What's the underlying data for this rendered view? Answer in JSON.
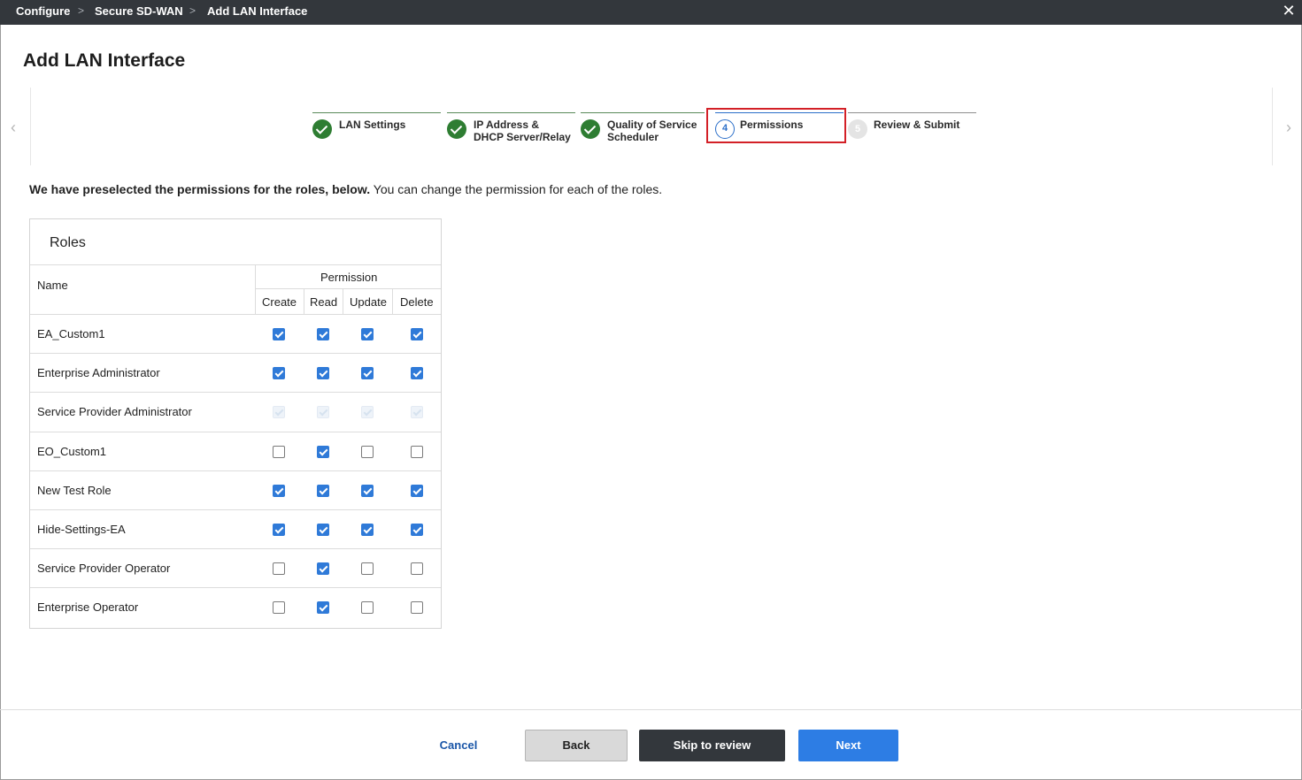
{
  "breadcrumb": {
    "items": [
      "Configure",
      "Secure SD-WAN",
      "Add LAN Interface"
    ],
    "separator": ">"
  },
  "close_icon": "close-icon",
  "page_title": "Add LAN Interface",
  "wizard": {
    "steps": [
      {
        "label": "LAN Settings",
        "status": "completed"
      },
      {
        "label": "IP Address & DHCP Server/Relay",
        "status": "completed"
      },
      {
        "label": "Quality of Service Scheduler",
        "status": "completed"
      },
      {
        "label": "Permissions",
        "status": "current",
        "number": "4"
      },
      {
        "label": "Review & Submit",
        "status": "upcoming",
        "number": "5"
      }
    ],
    "prev_arrow": "‹",
    "next_arrow": "›"
  },
  "intro": {
    "bold": "We have preselected the permissions for the roles, below.",
    "rest": " You can change the permission for each of the roles."
  },
  "roles": {
    "title": "Roles",
    "name_header": "Name",
    "permission_header": "Permission",
    "columns": [
      "Create",
      "Read",
      "Update",
      "Delete"
    ],
    "rows": [
      {
        "name": "EA_Custom1",
        "perms": [
          "on",
          "on",
          "on",
          "on"
        ]
      },
      {
        "name": "Enterprise Administrator",
        "perms": [
          "on",
          "on",
          "on",
          "on"
        ]
      },
      {
        "name": "Service Provider Administrator",
        "perms": [
          "dis",
          "dis",
          "dis",
          "dis"
        ]
      },
      {
        "name": "EO_Custom1",
        "perms": [
          "off",
          "on",
          "off",
          "off"
        ]
      },
      {
        "name": "New Test Role",
        "perms": [
          "on",
          "on",
          "on",
          "on"
        ]
      },
      {
        "name": "Hide-Settings-EA",
        "perms": [
          "on",
          "on",
          "on",
          "on"
        ]
      },
      {
        "name": "Service Provider Operator",
        "perms": [
          "off",
          "on",
          "off",
          "off"
        ]
      },
      {
        "name": "Enterprise Operator",
        "perms": [
          "off",
          "on",
          "off",
          "off"
        ]
      }
    ]
  },
  "footer": {
    "cancel": "Cancel",
    "back": "Back",
    "skip": "Skip to review",
    "next": "Next"
  },
  "colors": {
    "topbar": "#33373c",
    "completed": "#2e7d32",
    "current": "#2b6fc9",
    "highlight": "#d32027",
    "checkbox": "#2f7ad8",
    "primary_button": "#2d7de4"
  }
}
